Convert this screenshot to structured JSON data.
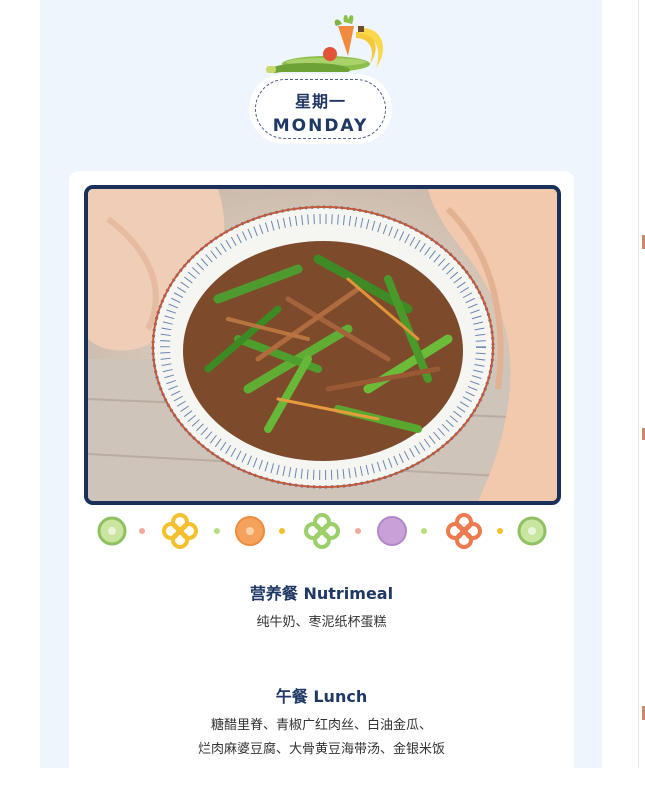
{
  "day": {
    "cn": "星期一",
    "en": "MONDAY"
  },
  "photo": {
    "alt": "青椒肉丝"
  },
  "meals": [
    {
      "title": "营养餐 Nutrimeal",
      "lines": [
        "纯牛奶、枣泥纸杯蛋糕"
      ]
    },
    {
      "title": "午餐 Lunch",
      "lines": [
        "糖醋里脊、青椒广红肉丝、白油金瓜、",
        "烂肉麻婆豆腐、大骨黄豆海带汤、金银米饭"
      ]
    }
  ],
  "colors": {
    "navy": "#1f3864",
    "page_bg": "#eef5fd",
    "card_bg": "#ffffff"
  }
}
